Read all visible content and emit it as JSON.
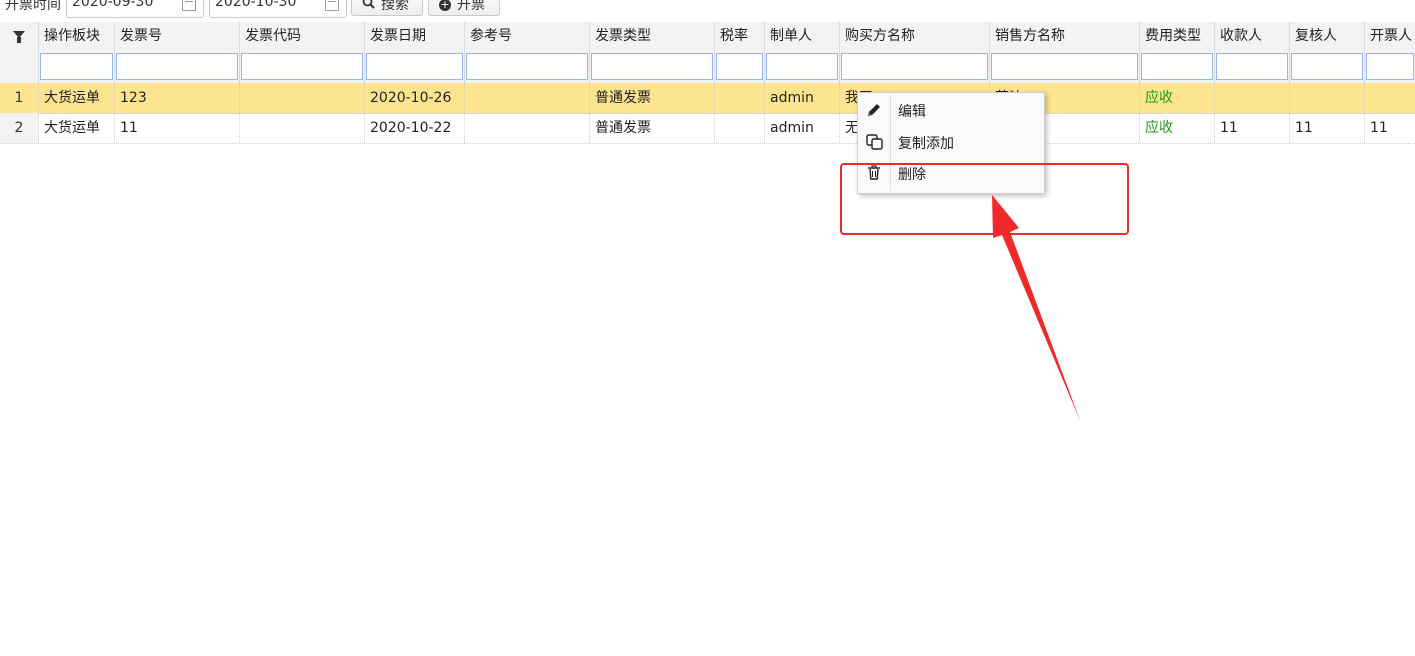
{
  "toolbar": {
    "date_label": "开票时间",
    "start_date": "2020-09-30",
    "end_date": "2020-10-30",
    "search_label": "搜索",
    "invoice_label": "开票"
  },
  "table": {
    "columns": [
      "操作板块",
      "发票号",
      "发票代码",
      "发票日期",
      "参考号",
      "发票类型",
      "税率",
      "制单人",
      "购买方名称",
      "销售方名称",
      "费用类型",
      "收款人",
      "复核人",
      "开票人"
    ],
    "rows": [
      {
        "num": "1",
        "cells": [
          "大货运单",
          "123",
          "",
          "2020-10-26",
          "",
          "普通发票",
          "",
          "admin",
          "我司",
          "莫沙",
          "应收",
          "",
          "",
          ""
        ]
      },
      {
        "num": "2",
        "cells": [
          "大货运单",
          "11",
          "",
          "2020-10-22",
          "",
          "普通发票",
          "",
          "admin",
          "无",
          "",
          "应收",
          "11",
          "11",
          "11"
        ]
      }
    ]
  },
  "context_menu": {
    "items": [
      {
        "label": "编辑",
        "icon": "pencil-icon"
      },
      {
        "label": "复制添加",
        "icon": "copy-icon"
      },
      {
        "label": "删除",
        "icon": "trash-icon"
      }
    ]
  },
  "colors": {
    "selected_row": "#fde58f",
    "fee_type_text": "#1e9b1e",
    "annotation": "#f02a2a"
  }
}
